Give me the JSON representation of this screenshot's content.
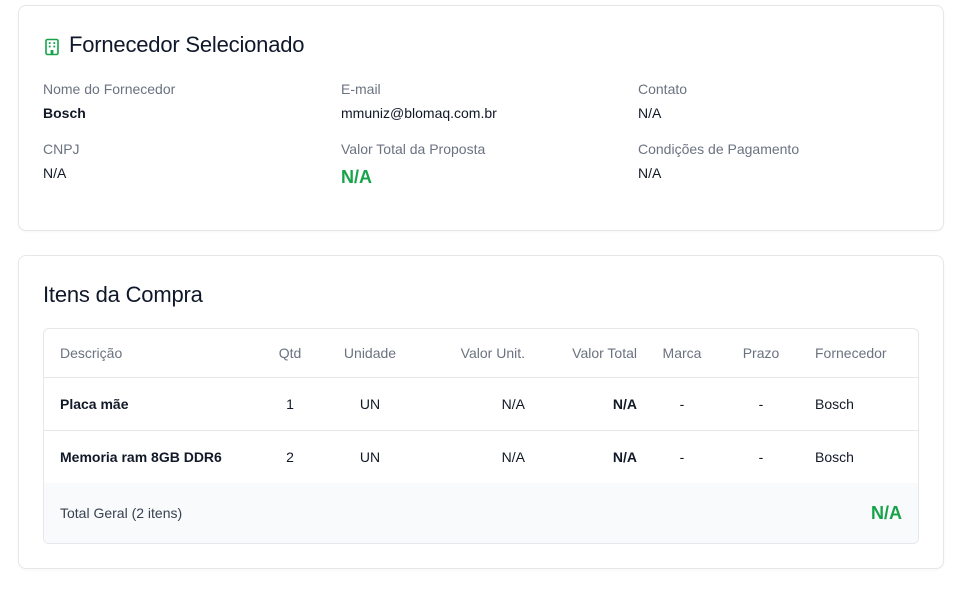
{
  "supplier_card": {
    "title": "Fornecedor Selecionado",
    "icon": "building-icon",
    "fields": {
      "nome": {
        "label": "Nome do Fornecedor",
        "value": "Bosch"
      },
      "email": {
        "label": "E-mail",
        "value": "mmuniz@blomaq.com.br"
      },
      "contato": {
        "label": "Contato",
        "value": "N/A"
      },
      "cnpj": {
        "label": "CNPJ",
        "value": "N/A"
      },
      "valor_total": {
        "label": "Valor Total da Proposta",
        "value": "N/A"
      },
      "condicoes": {
        "label": "Condições de Pagamento",
        "value": "N/A"
      }
    }
  },
  "items_card": {
    "title": "Itens da Compra",
    "columns": {
      "descricao": "Descrição",
      "qtd": "Qtd",
      "unidade": "Unidade",
      "valor_unit": "Valor Unit.",
      "valor_total": "Valor Total",
      "marca": "Marca",
      "prazo": "Prazo",
      "fornecedor": "Fornecedor"
    },
    "rows": [
      {
        "descricao": "Placa mãe",
        "qtd": "1",
        "unidade": "UN",
        "valor_unit": "N/A",
        "valor_total": "N/A",
        "marca": "-",
        "prazo": "-",
        "fornecedor": "Bosch"
      },
      {
        "descricao": "Memoria ram 8GB DDR6",
        "qtd": "2",
        "unidade": "UN",
        "valor_unit": "N/A",
        "valor_total": "N/A",
        "marca": "-",
        "prazo": "-",
        "fornecedor": "Bosch"
      }
    ],
    "total": {
      "label": "Total Geral (2 itens)",
      "value": "N/A"
    }
  },
  "colors": {
    "accent_green": "#16a34a",
    "muted_text": "#6b7280",
    "border": "#e5e7eb"
  }
}
